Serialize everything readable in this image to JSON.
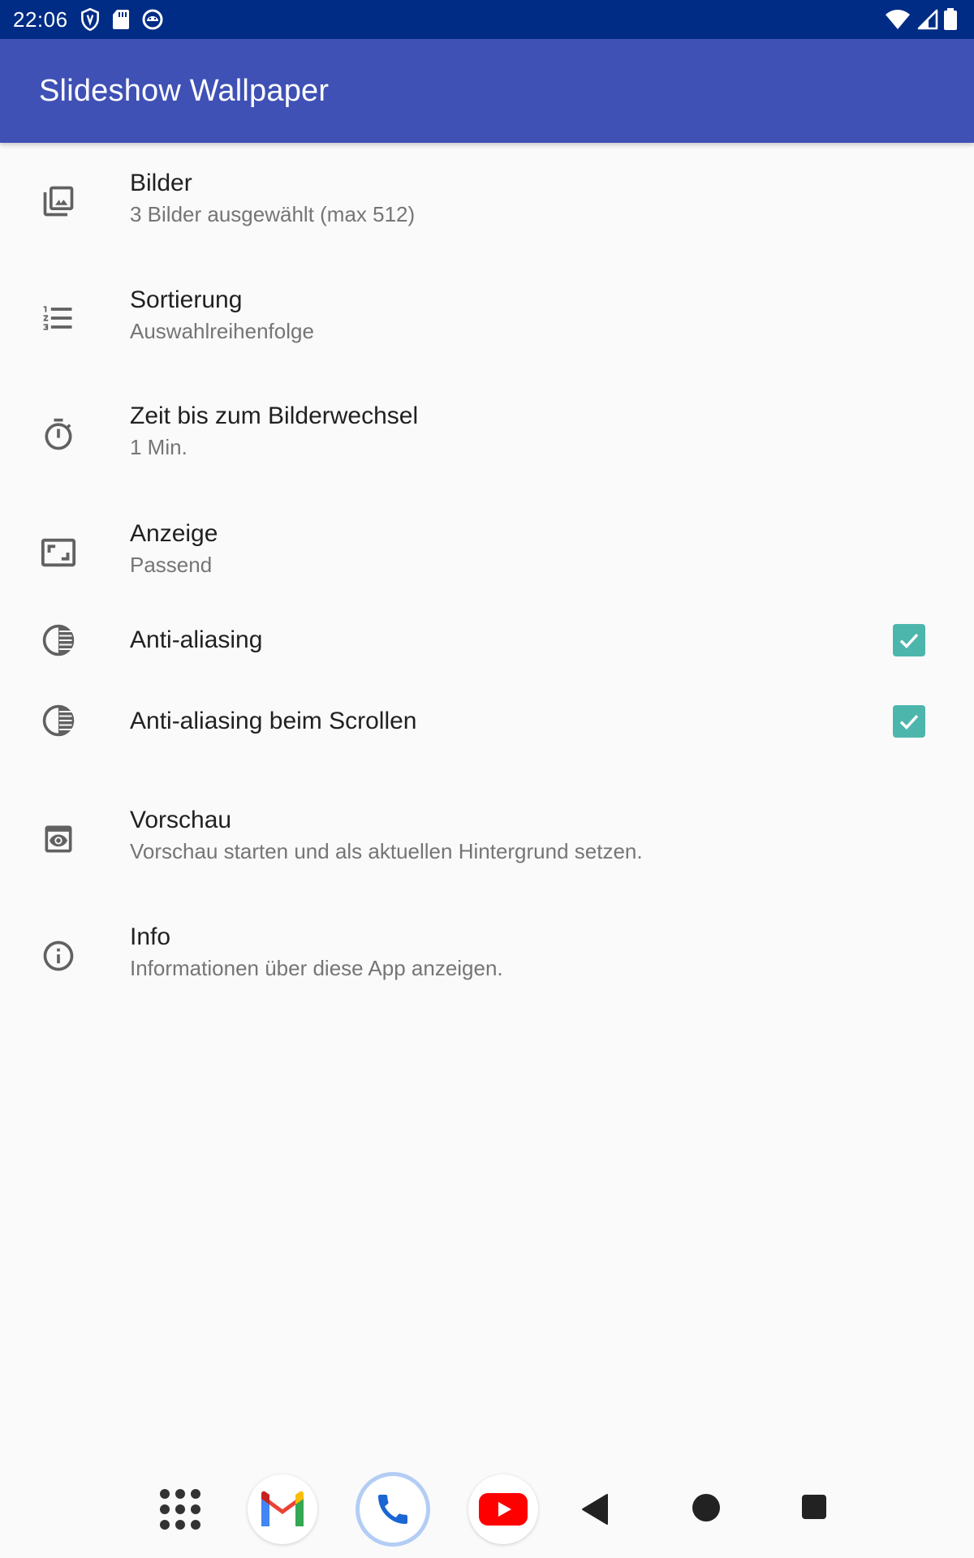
{
  "status_bar": {
    "time": "22:06",
    "left_icons": [
      "shield-icon",
      "sd-card-icon",
      "android-icon"
    ],
    "right_icons": [
      "wifi-icon",
      "signal-icon",
      "battery-icon"
    ]
  },
  "app_bar": {
    "title": "Slideshow Wallpaper",
    "color": "#3f51b5"
  },
  "preferences": [
    {
      "icon": "image-library-icon",
      "title": "Bilder",
      "summary": "3 Bilder ausgewählt (max 512)"
    },
    {
      "icon": "numbered-list-icon",
      "title": "Sortierung",
      "summary": "Auswahlreihenfolge"
    },
    {
      "icon": "timer-icon",
      "title": "Zeit bis zum Bilderwechsel",
      "summary": "1 Min."
    },
    {
      "icon": "aspect-ratio-icon",
      "title": "Anzeige",
      "summary": "Passend"
    },
    {
      "icon": "gradient-icon",
      "title": "Anti-aliasing",
      "checked": true
    },
    {
      "icon": "gradient-icon",
      "title": "Anti-aliasing beim Scrollen",
      "checked": true
    },
    {
      "icon": "preview-icon",
      "title": "Vorschau",
      "summary": "Vorschau starten und als aktuellen Hintergrund setzen."
    },
    {
      "icon": "info-icon",
      "title": "Info",
      "summary": "Informationen über diese App anzeigen."
    }
  ],
  "checkbox_color": "#4db6ac",
  "nav_bar": {
    "items": [
      "app-drawer-icon",
      "gmail-icon",
      "phone-icon",
      "youtube-icon",
      "back-icon",
      "home-icon",
      "recents-icon"
    ]
  }
}
